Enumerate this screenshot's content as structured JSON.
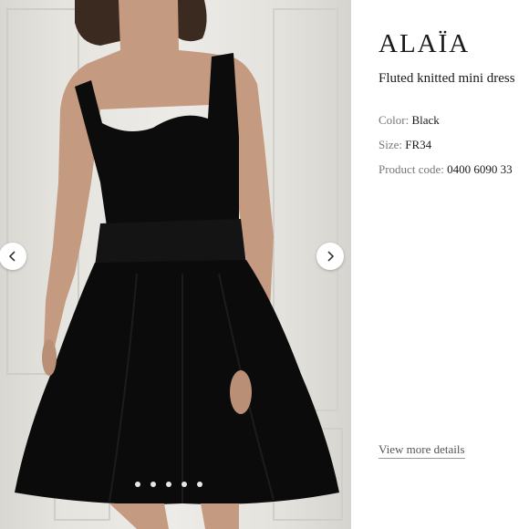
{
  "gallery": {
    "image_description_icon": "product-photo",
    "prev_icon": "chevron-left-icon",
    "next_icon": "chevron-right-icon",
    "slide_count": 5,
    "active_slide": 1
  },
  "product": {
    "brand": "ALAÏA",
    "name": "Fluted knitted mini dress",
    "color_label": "Color:",
    "color_value": "Black",
    "size_label": "Size:",
    "size_value": "FR34",
    "code_label": "Product code:",
    "code_value": "0400 6090 33"
  },
  "links": {
    "view_more": "View more details"
  }
}
